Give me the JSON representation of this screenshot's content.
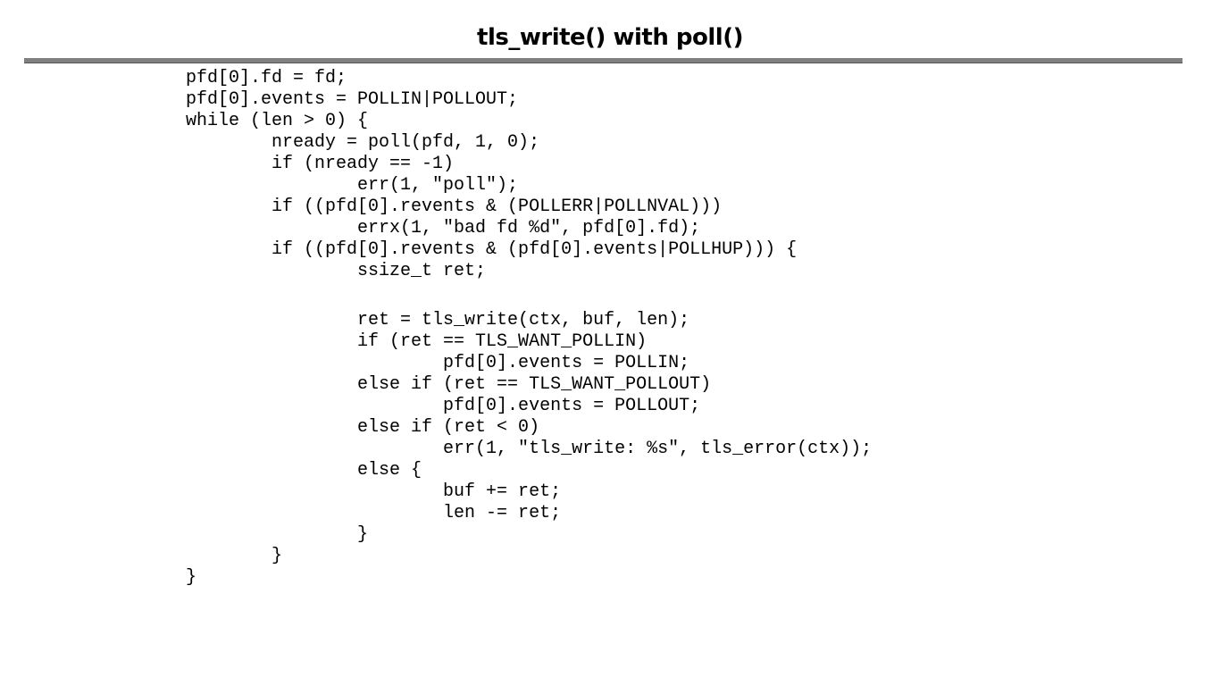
{
  "slide": {
    "title": "tls_write() with poll()"
  },
  "code": {
    "lines": [
      "pfd[0].fd = fd;",
      "pfd[0].events = POLLIN|POLLOUT;",
      "while (len > 0) {",
      "        nready = poll(pfd, 1, 0);",
      "        if (nready == -1)",
      "                err(1, \"poll\");",
      "        if ((pfd[0].revents & (POLLERR|POLLNVAL)))",
      "                errx(1, \"bad fd %d\", pfd[0].fd);",
      "        if ((pfd[0].revents & (pfd[0].events|POLLHUP))) {",
      "                ssize_t ret;",
      "",
      "                ret = tls_write(ctx, buf, len);",
      "                if (ret == TLS_WANT_POLLIN)",
      "                        pfd[0].events = POLLIN;",
      "                else if (ret == TLS_WANT_POLLOUT)",
      "                        pfd[0].events = POLLOUT;",
      "                else if (ret < 0)",
      "                        err(1, \"tls_write: %s\", tls_error(ctx));",
      "                else {",
      "                        buf += ret;",
      "                        len -= ret;",
      "                }",
      "        }",
      "}"
    ]
  }
}
